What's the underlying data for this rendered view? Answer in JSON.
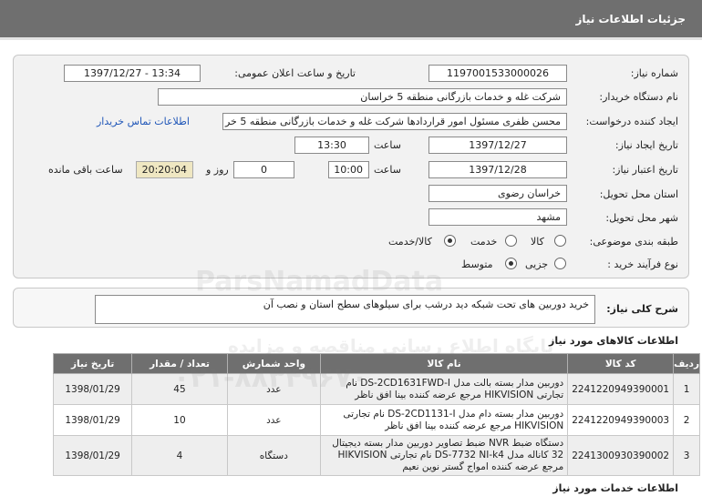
{
  "header": {
    "title": "جزئیات اطلاعات نیاز"
  },
  "form": {
    "need_number_label": "شماره نیاز:",
    "need_number": "1197001533000026",
    "announce_label": "تاریخ و ساعت اعلان عمومی:",
    "announce_value": "1397/12/27 - 13:34",
    "buyer_org_label": "نام دستگاه خریدار:",
    "buyer_org": "شرکت غله و خدمات بازرگانی منطقه 5 خراسان",
    "requester_label": "ایجاد کننده درخواست:",
    "requester": "محسن ظفری مسئول امور قراردادها شرکت غله و خدمات بازرگانی منطقه 5 خر",
    "contact_link": "اطلاعات تماس خریدار",
    "created_date_label": "تاریخ ایجاد نیاز:",
    "created_date": "1397/12/27",
    "hour_label": "ساعت",
    "created_time": "13:30",
    "valid_date_label": "تاریخ اعتبار نیاز:",
    "valid_date": "1397/12/28",
    "valid_time": "10:00",
    "days_value": "0",
    "day_and_label": "روز و",
    "countdown": "20:20:04",
    "remaining_label": "ساعت باقی مانده",
    "province_label": "استان محل تحویل:",
    "province": "خراسان رضوی",
    "city_label": "شهر محل تحویل:",
    "city": "مشهد",
    "category_label": "طبقه بندی موضوعی:",
    "category_options": [
      "کالا",
      "خدمت",
      "کالا/خدمت"
    ],
    "category_selected": "کالا/خدمت",
    "process_label": "نوع فرآیند خرید :",
    "process_options": [
      "جزیی",
      "متوسط"
    ],
    "process_selected": "متوسط"
  },
  "description": {
    "label": "شرح کلی نیاز:",
    "text": "خرید دوربین های تحت شبکه دید درشب برای سیلوهای سطح استان و نصب آن"
  },
  "goods": {
    "title": "اطلاعات کالاهای مورد نیاز",
    "headers": [
      "ردیف",
      "کد کالا",
      "نام کالا",
      "واحد شمارش",
      "تعداد / مقدار",
      "تاریخ نیاز"
    ],
    "rows": [
      {
        "row": "1",
        "code": "2241220949390001",
        "name": "دوربین مدار بسته بالت مدل DS-2CD1631FWD-I نام تجارتی HIKVISION مرجع عرضه کننده بینا افق ناظر",
        "unit": "عدد",
        "qty": "45",
        "date": "1398/01/29"
      },
      {
        "row": "2",
        "code": "2241220949390003",
        "name": "دوربین مدار بسته دام مدل DS-2CD1131-I نام تجارتی HIKVISION مرجع عرضه کننده بینا افق ناظر",
        "unit": "عدد",
        "qty": "10",
        "date": "1398/01/29"
      },
      {
        "row": "3",
        "code": "2241300930390002",
        "name": "دستگاه ضبط NVR ضبط تصاویر دوربین مدار بسته دیجیتال 32 کاناله مدل DS-7732 NI-k4 نام تجارتی HIKVISION مرجع عرضه کننده امواج گستر نوین نعیم",
        "unit": "دستگاه",
        "qty": "4",
        "date": "1398/01/29"
      }
    ]
  },
  "services": {
    "title": "اطلاعات خدمات مورد نیاز"
  },
  "watermark": {
    "brand": "ParsNamadData",
    "line1": "پایگاه اطلاع رسانی مناقصه و مزایده",
    "phone": "۰۲۱-۸۸۳۴۹۶۷۰"
  }
}
